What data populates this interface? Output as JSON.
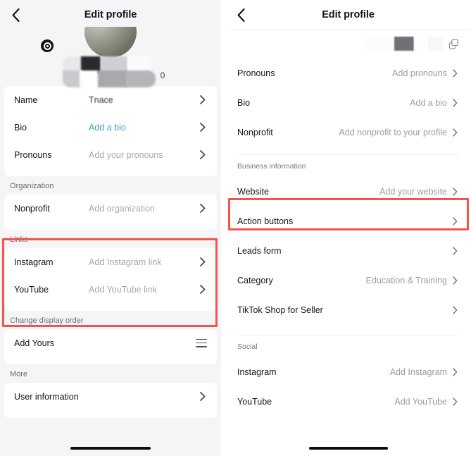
{
  "left_screen": {
    "header": {
      "title": "Edit profile",
      "back_icon": "chevron-left-icon"
    },
    "avatar": {
      "camera_icon": "camera-badge-icon",
      "username_trailing": "0"
    },
    "profile_section": {
      "rows": [
        {
          "label": "Name",
          "value": "Tnace",
          "state": "filled"
        },
        {
          "label": "Bio",
          "value": "Add a bio",
          "state": "accent"
        },
        {
          "label": "Pronouns",
          "value": "Add your pronouns",
          "state": "placeholder"
        }
      ]
    },
    "organization_section": {
      "title": "Organization",
      "rows": [
        {
          "label": "Nonprofit",
          "value": "Add organization",
          "state": "placeholder"
        }
      ]
    },
    "links_section": {
      "title": "Links",
      "rows": [
        {
          "label": "Instagram",
          "value": "Add Instagram link",
          "state": "placeholder"
        },
        {
          "label": "YouTube",
          "value": "Add YouTube link",
          "state": "placeholder"
        }
      ]
    },
    "display_order_section": {
      "title": "Change display order",
      "rows": [
        {
          "label": "Add Yours",
          "icon": "hamburger-drag-icon"
        }
      ]
    },
    "more_section": {
      "title": "More",
      "rows": [
        {
          "label": "User information",
          "value": "",
          "state": "placeholder"
        }
      ]
    }
  },
  "right_screen": {
    "header": {
      "title": "Edit profile",
      "back_icon": "chevron-left-icon"
    },
    "top_bar": {
      "copy_icon": "copy-icon"
    },
    "account_rows": [
      {
        "label": "Pronouns",
        "value": "Add pronouns"
      },
      {
        "label": "Bio",
        "value": "Add a bio"
      },
      {
        "label": "Nonprofit",
        "value": "Add nonprofit to your profile"
      }
    ],
    "business_section": {
      "title": "Business information",
      "rows": [
        {
          "label": "Website",
          "value": "Add your website"
        },
        {
          "label": "Action buttons",
          "value": ""
        },
        {
          "label": "Leads form",
          "value": ""
        },
        {
          "label": "Category",
          "value": "Education & Training"
        },
        {
          "label": "TikTok Shop for Seller",
          "value": ""
        }
      ]
    },
    "social_section": {
      "title": "Social",
      "rows": [
        {
          "label": "Instagram",
          "value": "Add Instagram"
        },
        {
          "label": "YouTube",
          "value": "Add YouTube"
        }
      ]
    }
  },
  "annotations": {
    "highlight_color": "#f0564a",
    "boxes": [
      {
        "name": "links-section-highlight",
        "target": "Links"
      },
      {
        "name": "website-row-highlight",
        "target": "Website"
      }
    ]
  },
  "colors": {
    "background": "#f5f4f7",
    "card": "#ffffff",
    "text_primary": "#16151a",
    "text_placeholder": "#a8a7ad",
    "accent_link": "#3aa5bd",
    "highlight": "#f0564a"
  }
}
